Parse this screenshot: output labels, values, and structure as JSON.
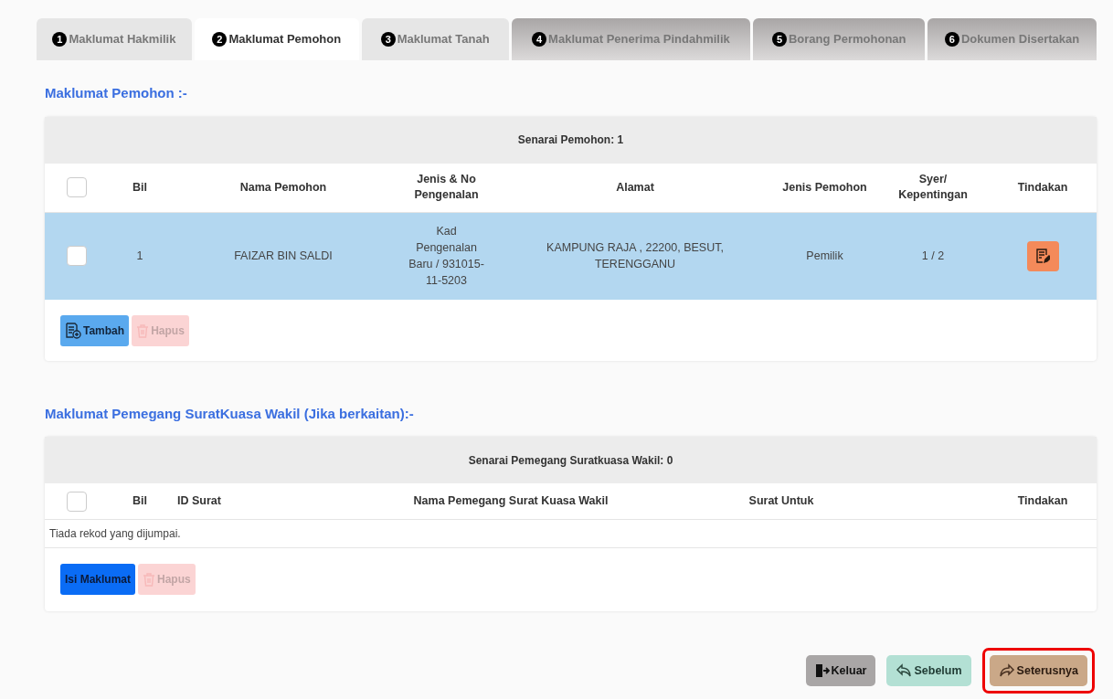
{
  "tabs": [
    {
      "number": "1",
      "label": "Maklumat Hakmilik",
      "selected": false,
      "disabled": false
    },
    {
      "number": "2",
      "label": "Maklumat Pemohon",
      "selected": true,
      "disabled": false
    },
    {
      "number": "3",
      "label": "Maklumat Tanah",
      "selected": false,
      "disabled": false
    },
    {
      "number": "4",
      "label": "Maklumat Penerima Pindahmilik",
      "selected": false,
      "disabled": true
    },
    {
      "number": "5",
      "label": "Borang Permohonan",
      "selected": false,
      "disabled": true
    },
    {
      "number": "6",
      "label": "Dokumen Disertakan",
      "selected": false,
      "disabled": true
    }
  ],
  "sections": [
    {
      "title": "Maklumat Pemohon :-",
      "caption": "Senarai Pemohon: 1",
      "select_all_checked": false,
      "columns": [
        "Bil",
        "Nama Pemohon",
        "Jenis & No Pengenalan",
        "Alamat",
        "Jenis Pemohon",
        "Syer/ Kepentingan",
        "Tindakan"
      ],
      "rows": [
        {
          "selected": true,
          "checked": false,
          "cells": [
            "1",
            "FAIZAR BIN SALDI",
            "Kad Pengenalan Baru / 931015-11-5203",
            "KAMPUNG RAJA , 22200, BESUT, TERENGGANU",
            "Pemilik",
            "1 / 2"
          ]
        }
      ],
      "buttons": [
        {
          "kind": "add",
          "label": "Tambah",
          "disabled": false
        },
        {
          "kind": "delete",
          "label": "Hapus",
          "disabled": true
        }
      ]
    },
    {
      "title": "Maklumat Pemegang SuratKuasa Wakil (Jika berkaitan):-",
      "caption": "Senarai Pemegang Suratkuasa Wakil: 0",
      "select_all_checked": false,
      "columns": [
        "Bil",
        "ID Surat",
        "Nama Pemegang Surat Kuasa Wakil",
        "Surat Untuk",
        "Tindakan"
      ],
      "empty_message": "Tiada rekod yang dijumpai.",
      "buttons": [
        {
          "kind": "fill",
          "label": "Isi Maklumat",
          "disabled": false
        },
        {
          "kind": "delete",
          "label": "Hapus",
          "disabled": true
        }
      ]
    }
  ],
  "nav_buttons": [
    {
      "kind": "exit",
      "label": "Keluar",
      "highlighted": false
    },
    {
      "kind": "back",
      "label": "Sebelum",
      "highlighted": false
    },
    {
      "kind": "next",
      "label": "Seterusnya",
      "highlighted": true
    }
  ]
}
